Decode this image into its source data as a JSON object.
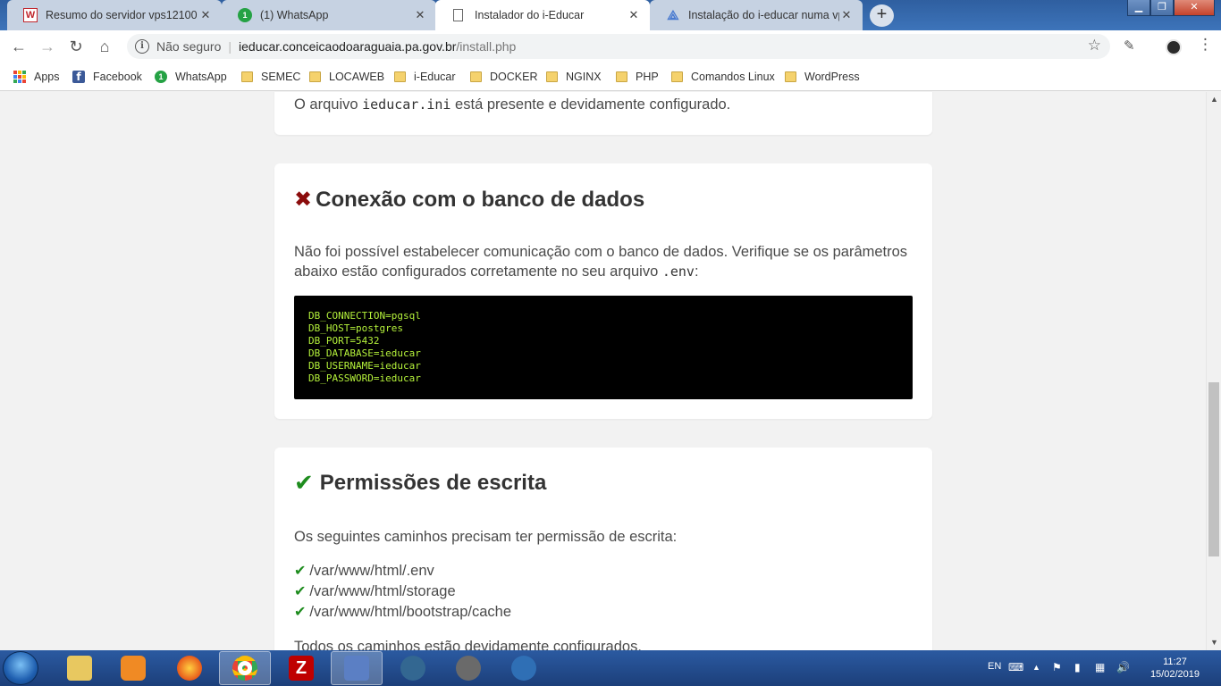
{
  "browser": {
    "tabs": [
      {
        "title": "Resumo do servidor vps12100",
        "icon": "w-icon",
        "active": false
      },
      {
        "title": "(1) WhatsApp",
        "icon": "whatsapp-icon",
        "active": false
      },
      {
        "title": "Instalador do i-Educar",
        "icon": "page-icon",
        "active": true
      },
      {
        "title": "Instalação do i-educar numa vps",
        "icon": "doc-icon",
        "active": false
      }
    ],
    "new_tab_label": "+",
    "address": {
      "security_label": "Não seguro",
      "host": "ieducar.conceicaodoaraguaia.pa.gov.br",
      "path": "/install.php"
    },
    "bookmarks": [
      {
        "label": "Apps",
        "icon": "apps-grid-icon"
      },
      {
        "label": "Facebook",
        "icon": "facebook-icon"
      },
      {
        "label": "WhatsApp",
        "icon": "whatsapp-icon"
      },
      {
        "label": "SEMEC",
        "icon": "folder-icon"
      },
      {
        "label": "LOCAWEB",
        "icon": "folder-icon"
      },
      {
        "label": "i-Educar",
        "icon": "folder-icon"
      },
      {
        "label": "DOCKER",
        "icon": "folder-icon"
      },
      {
        "label": "NGINX",
        "icon": "folder-icon"
      },
      {
        "label": "PHP",
        "icon": "folder-icon"
      },
      {
        "label": "Comandos Linux",
        "icon": "folder-icon"
      },
      {
        "label": "WordPress",
        "icon": "folder-icon"
      }
    ]
  },
  "page": {
    "config_card": {
      "text_before": "O arquivo ",
      "file": "ieducar.ini",
      "text_after": " está presente e devidamente configurado."
    },
    "db_card": {
      "status": "error",
      "title": "Conexão com o banco de dados",
      "message_before": "Não foi possível estabelecer comunicação com o banco de dados. Verifique se os parâmetros abaixo estão configurados corretamente no seu arquivo ",
      "message_file": ".env",
      "message_after": ":",
      "env_lines": [
        "DB_CONNECTION=pgsql",
        "DB_HOST=postgres",
        "DB_PORT=5432",
        "DB_DATABASE=ieducar",
        "DB_USERNAME=ieducar",
        "DB_PASSWORD=ieducar"
      ]
    },
    "perm_card": {
      "status": "ok",
      "title": "Permissões de escrita",
      "intro": "Os seguintes caminhos precisam ter permissão de escrita:",
      "paths": [
        "/var/www/html/.env",
        "/var/www/html/storage",
        "/var/www/html/bootstrap/cache"
      ],
      "footer": "Todos os caminhos estão devidamente configurados."
    }
  },
  "taskbar": {
    "apps": [
      {
        "name": "explorer",
        "icon": "folder-icon",
        "color": "#e8c860"
      },
      {
        "name": "media",
        "icon": "media-icon",
        "color": "#f08a24"
      },
      {
        "name": "firefox",
        "icon": "firefox-icon",
        "color": "#e8591a"
      },
      {
        "name": "chrome",
        "icon": "chrome-icon",
        "color": "#4a8af4",
        "active": true
      },
      {
        "name": "filezilla",
        "icon": "filezilla-icon",
        "color": "#bf0000"
      },
      {
        "name": "putty",
        "icon": "putty-icon",
        "color": "#5b7fc4"
      },
      {
        "name": "postgres",
        "icon": "elephant-icon",
        "color": "#336791"
      },
      {
        "name": "video",
        "icon": "film-icon",
        "color": "#6a6a6a"
      },
      {
        "name": "thunderbird",
        "icon": "mail-icon",
        "color": "#2f6fb5"
      }
    ],
    "language": "EN",
    "time": "11:27",
    "date": "15/02/2019"
  }
}
